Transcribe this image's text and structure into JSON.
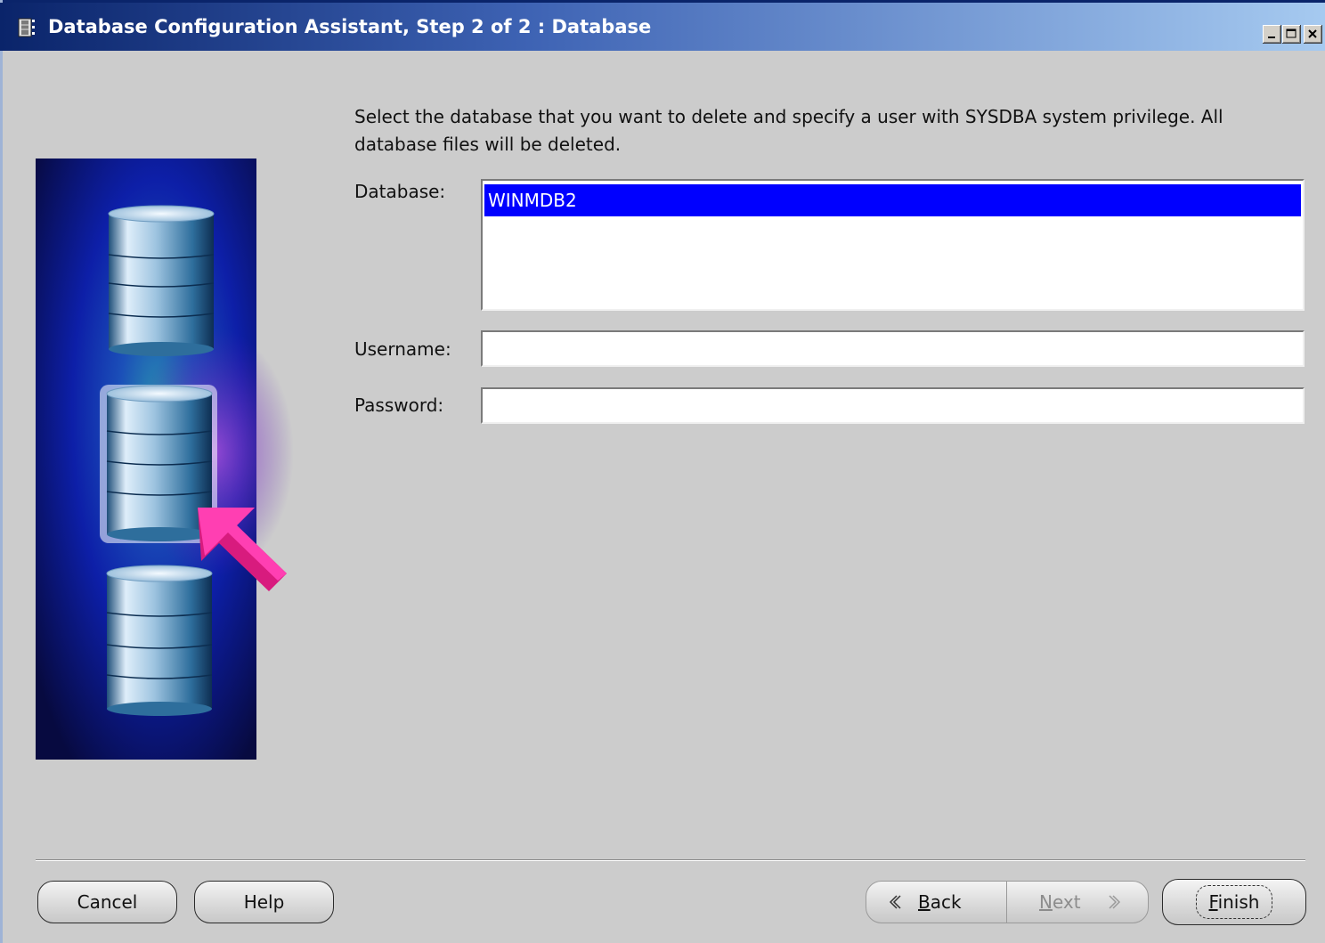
{
  "window": {
    "title": "Database Configuration Assistant, Step 2 of 2 : Database",
    "controls": [
      "minimize-icon",
      "maximize-icon",
      "close-icon"
    ]
  },
  "content": {
    "instruction": "Select the database that you want to delete and specify a user with SYSDBA system privilege. All database files will be deleted.",
    "database_label": "Database:",
    "database_items": [
      "WINMDB2"
    ],
    "selected_database": "WINMDB2",
    "username_label": "Username:",
    "username_value": "",
    "password_label": "Password:",
    "password_value": ""
  },
  "buttons": {
    "cancel": "Cancel",
    "help": "Help",
    "back_prefix": "",
    "back_mnemonic": "B",
    "back_rest": "ack",
    "next_mnemonic": "N",
    "next_rest": "ext",
    "finish_mnemonic": "F",
    "finish_rest": "inish",
    "next_enabled": false
  },
  "colors": {
    "selection": "#0000ff",
    "background": "#cccccc",
    "arrow": "#e91e8c"
  }
}
